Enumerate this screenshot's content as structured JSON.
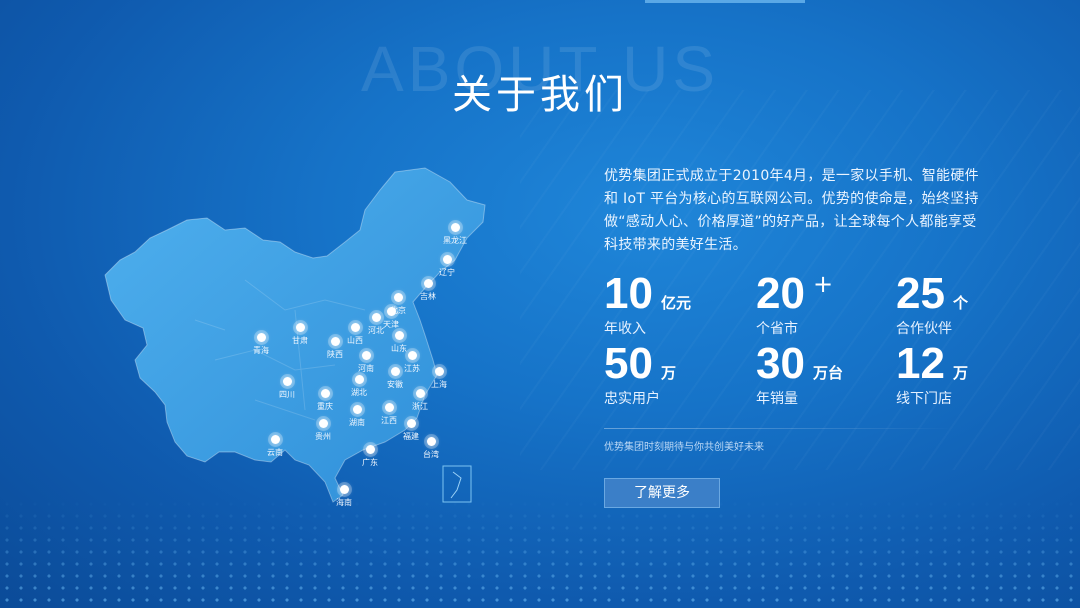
{
  "header": {
    "bg_title": "ABOUT US",
    "title": "关于我们"
  },
  "intro": "优势集团正式成立于2010年4月，是一家以手机、智能硬件和 IoT 平台为核心的互联网公司。优势的使命是，始终坚持做“感动人心、价格厚道”的好产品，让全球每个人都能享受科技带来的美好生活。",
  "stats": [
    {
      "value": "10",
      "unit": "亿元",
      "label": "年收入"
    },
    {
      "value": "20",
      "unit": "+",
      "label": "个省市"
    },
    {
      "value": "25",
      "unit": "个",
      "label": "合作伙伴"
    },
    {
      "value": "50",
      "unit": "万",
      "label": "忠实用户"
    },
    {
      "value": "30",
      "unit": "万台",
      "label": "年销量"
    },
    {
      "value": "12",
      "unit": "万",
      "label": "线下门店"
    }
  ],
  "slogan": "优势集团时刻期待与你共创美好未来",
  "button": {
    "label": "了解更多"
  },
  "map": {
    "cities": [
      "黑龙江",
      "辽宁",
      "吉林",
      "北京",
      "天津",
      "河北",
      "山西",
      "山东",
      "甘肃",
      "青海",
      "陕西",
      "河南",
      "江苏",
      "上海",
      "安徽",
      "湖北",
      "四川",
      "重庆",
      "浙江",
      "江西",
      "湖南",
      "贵州",
      "福建",
      "云南",
      "广东",
      "台湾",
      "海南"
    ]
  },
  "colors": {
    "bg_center": "#1f86d9",
    "bg_edge": "#0b4b98",
    "map_fill": "#3aa0e6",
    "button_bg": "#3b7fc8"
  }
}
